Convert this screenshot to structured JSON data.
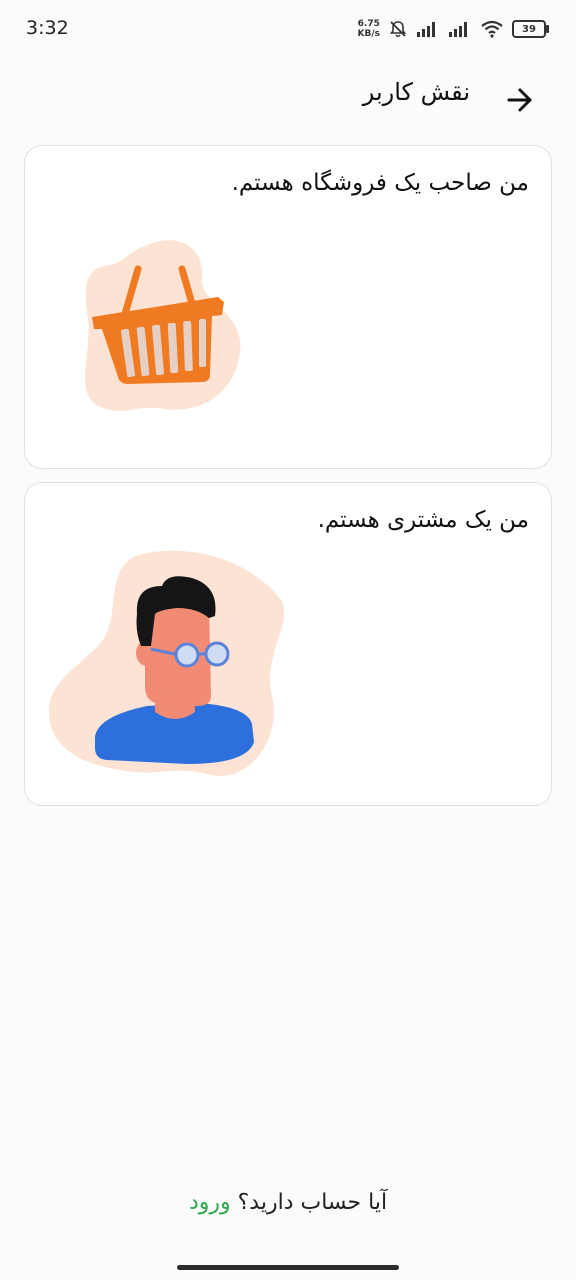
{
  "status_bar": {
    "time": "3:32",
    "net_speed_value": "6.75",
    "net_speed_unit": "KB/s",
    "battery_level": "39",
    "icons": [
      "mute-bell-icon",
      "signal-icon",
      "signal-icon",
      "wifi-icon",
      "battery-icon"
    ]
  },
  "header": {
    "title": "نقش کاربر",
    "back_icon": "arrow-right-icon"
  },
  "roles": [
    {
      "label": "من صاحب یک فروشگاه هستم.",
      "icon": "shopping-basket-illustration"
    },
    {
      "label": "من یک مشتری هستم.",
      "icon": "customer-avatar-illustration"
    }
  ],
  "footer": {
    "question": "آیا حساب دارید؟",
    "login_link": "ورود"
  },
  "colors": {
    "accent_green": "#2fa84f",
    "basket_orange": "#ef7a21",
    "blob_peach": "#fde3d3",
    "shirt_blue": "#2d6fdc"
  }
}
